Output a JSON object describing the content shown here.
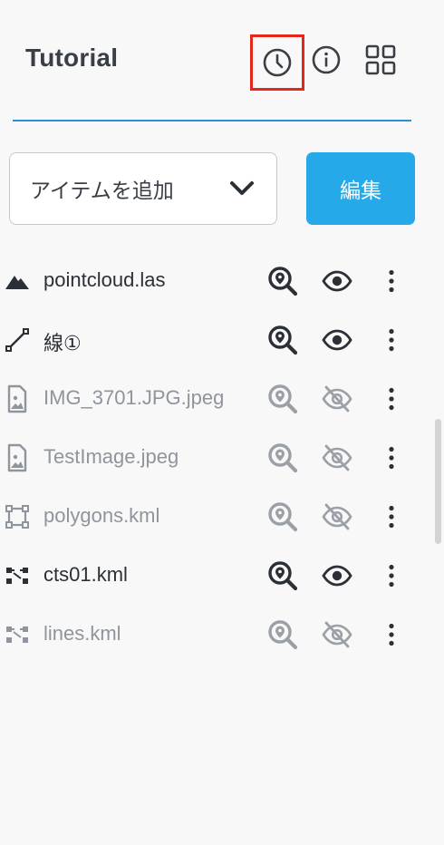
{
  "header": {
    "title": "Tutorial",
    "icons": [
      "history-icon",
      "info-icon",
      "grid-icon"
    ]
  },
  "add_item": {
    "label": "アイテムを追加",
    "icon": "chevron-down-icon"
  },
  "edit_button": {
    "label": "編集"
  },
  "colors": {
    "accent": "#25a9e8",
    "divider": "#2a8fd3",
    "highlight": "#e5261b",
    "inactive": "#8f959c"
  },
  "items": [
    {
      "name": "pointcloud.las",
      "type_icon": "mountain-icon",
      "visible": true
    },
    {
      "name": "線①",
      "type_icon": "line-icon",
      "visible": true
    },
    {
      "name": "IMG_3701.JPG.jpeg",
      "type_icon": "image-icon",
      "visible": false
    },
    {
      "name": "TestImage.jpeg",
      "type_icon": "image-icon",
      "visible": false
    },
    {
      "name": "polygons.kml",
      "type_icon": "polygon-icon",
      "visible": false
    },
    {
      "name": "cts01.kml",
      "type_icon": "points-icon",
      "visible": true
    },
    {
      "name": "lines.kml",
      "type_icon": "points-icon",
      "visible": false
    }
  ]
}
